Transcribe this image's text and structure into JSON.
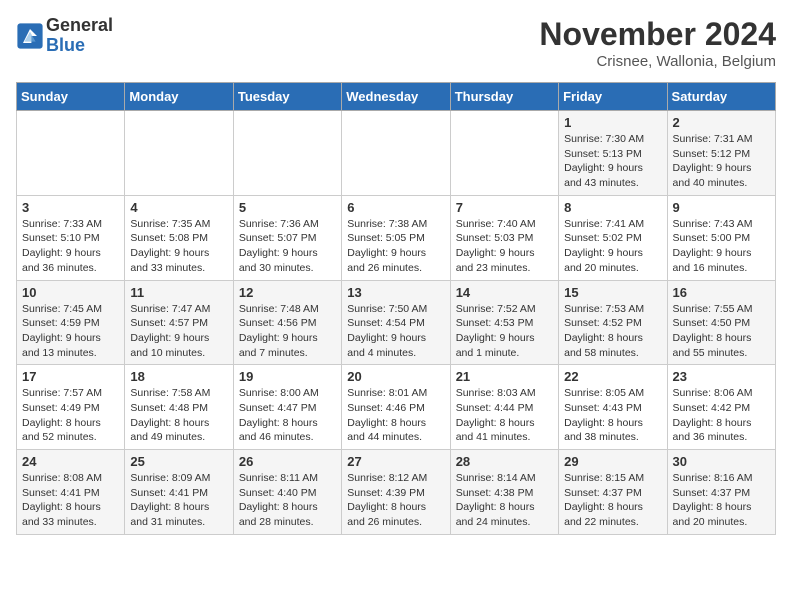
{
  "logo": {
    "general": "General",
    "blue": "Blue"
  },
  "title": "November 2024",
  "location": "Crisnee, Wallonia, Belgium",
  "days_of_week": [
    "Sunday",
    "Monday",
    "Tuesday",
    "Wednesday",
    "Thursday",
    "Friday",
    "Saturday"
  ],
  "weeks": [
    [
      {
        "day": "",
        "info": ""
      },
      {
        "day": "",
        "info": ""
      },
      {
        "day": "",
        "info": ""
      },
      {
        "day": "",
        "info": ""
      },
      {
        "day": "",
        "info": ""
      },
      {
        "day": "1",
        "info": "Sunrise: 7:30 AM\nSunset: 5:13 PM\nDaylight: 9 hours and 43 minutes."
      },
      {
        "day": "2",
        "info": "Sunrise: 7:31 AM\nSunset: 5:12 PM\nDaylight: 9 hours and 40 minutes."
      }
    ],
    [
      {
        "day": "3",
        "info": "Sunrise: 7:33 AM\nSunset: 5:10 PM\nDaylight: 9 hours and 36 minutes."
      },
      {
        "day": "4",
        "info": "Sunrise: 7:35 AM\nSunset: 5:08 PM\nDaylight: 9 hours and 33 minutes."
      },
      {
        "day": "5",
        "info": "Sunrise: 7:36 AM\nSunset: 5:07 PM\nDaylight: 9 hours and 30 minutes."
      },
      {
        "day": "6",
        "info": "Sunrise: 7:38 AM\nSunset: 5:05 PM\nDaylight: 9 hours and 26 minutes."
      },
      {
        "day": "7",
        "info": "Sunrise: 7:40 AM\nSunset: 5:03 PM\nDaylight: 9 hours and 23 minutes."
      },
      {
        "day": "8",
        "info": "Sunrise: 7:41 AM\nSunset: 5:02 PM\nDaylight: 9 hours and 20 minutes."
      },
      {
        "day": "9",
        "info": "Sunrise: 7:43 AM\nSunset: 5:00 PM\nDaylight: 9 hours and 16 minutes."
      }
    ],
    [
      {
        "day": "10",
        "info": "Sunrise: 7:45 AM\nSunset: 4:59 PM\nDaylight: 9 hours and 13 minutes."
      },
      {
        "day": "11",
        "info": "Sunrise: 7:47 AM\nSunset: 4:57 PM\nDaylight: 9 hours and 10 minutes."
      },
      {
        "day": "12",
        "info": "Sunrise: 7:48 AM\nSunset: 4:56 PM\nDaylight: 9 hours and 7 minutes."
      },
      {
        "day": "13",
        "info": "Sunrise: 7:50 AM\nSunset: 4:54 PM\nDaylight: 9 hours and 4 minutes."
      },
      {
        "day": "14",
        "info": "Sunrise: 7:52 AM\nSunset: 4:53 PM\nDaylight: 9 hours and 1 minute."
      },
      {
        "day": "15",
        "info": "Sunrise: 7:53 AM\nSunset: 4:52 PM\nDaylight: 8 hours and 58 minutes."
      },
      {
        "day": "16",
        "info": "Sunrise: 7:55 AM\nSunset: 4:50 PM\nDaylight: 8 hours and 55 minutes."
      }
    ],
    [
      {
        "day": "17",
        "info": "Sunrise: 7:57 AM\nSunset: 4:49 PM\nDaylight: 8 hours and 52 minutes."
      },
      {
        "day": "18",
        "info": "Sunrise: 7:58 AM\nSunset: 4:48 PM\nDaylight: 8 hours and 49 minutes."
      },
      {
        "day": "19",
        "info": "Sunrise: 8:00 AM\nSunset: 4:47 PM\nDaylight: 8 hours and 46 minutes."
      },
      {
        "day": "20",
        "info": "Sunrise: 8:01 AM\nSunset: 4:46 PM\nDaylight: 8 hours and 44 minutes."
      },
      {
        "day": "21",
        "info": "Sunrise: 8:03 AM\nSunset: 4:44 PM\nDaylight: 8 hours and 41 minutes."
      },
      {
        "day": "22",
        "info": "Sunrise: 8:05 AM\nSunset: 4:43 PM\nDaylight: 8 hours and 38 minutes."
      },
      {
        "day": "23",
        "info": "Sunrise: 8:06 AM\nSunset: 4:42 PM\nDaylight: 8 hours and 36 minutes."
      }
    ],
    [
      {
        "day": "24",
        "info": "Sunrise: 8:08 AM\nSunset: 4:41 PM\nDaylight: 8 hours and 33 minutes."
      },
      {
        "day": "25",
        "info": "Sunrise: 8:09 AM\nSunset: 4:41 PM\nDaylight: 8 hours and 31 minutes."
      },
      {
        "day": "26",
        "info": "Sunrise: 8:11 AM\nSunset: 4:40 PM\nDaylight: 8 hours and 28 minutes."
      },
      {
        "day": "27",
        "info": "Sunrise: 8:12 AM\nSunset: 4:39 PM\nDaylight: 8 hours and 26 minutes."
      },
      {
        "day": "28",
        "info": "Sunrise: 8:14 AM\nSunset: 4:38 PM\nDaylight: 8 hours and 24 minutes."
      },
      {
        "day": "29",
        "info": "Sunrise: 8:15 AM\nSunset: 4:37 PM\nDaylight: 8 hours and 22 minutes."
      },
      {
        "day": "30",
        "info": "Sunrise: 8:16 AM\nSunset: 4:37 PM\nDaylight: 8 hours and 20 minutes."
      }
    ]
  ]
}
